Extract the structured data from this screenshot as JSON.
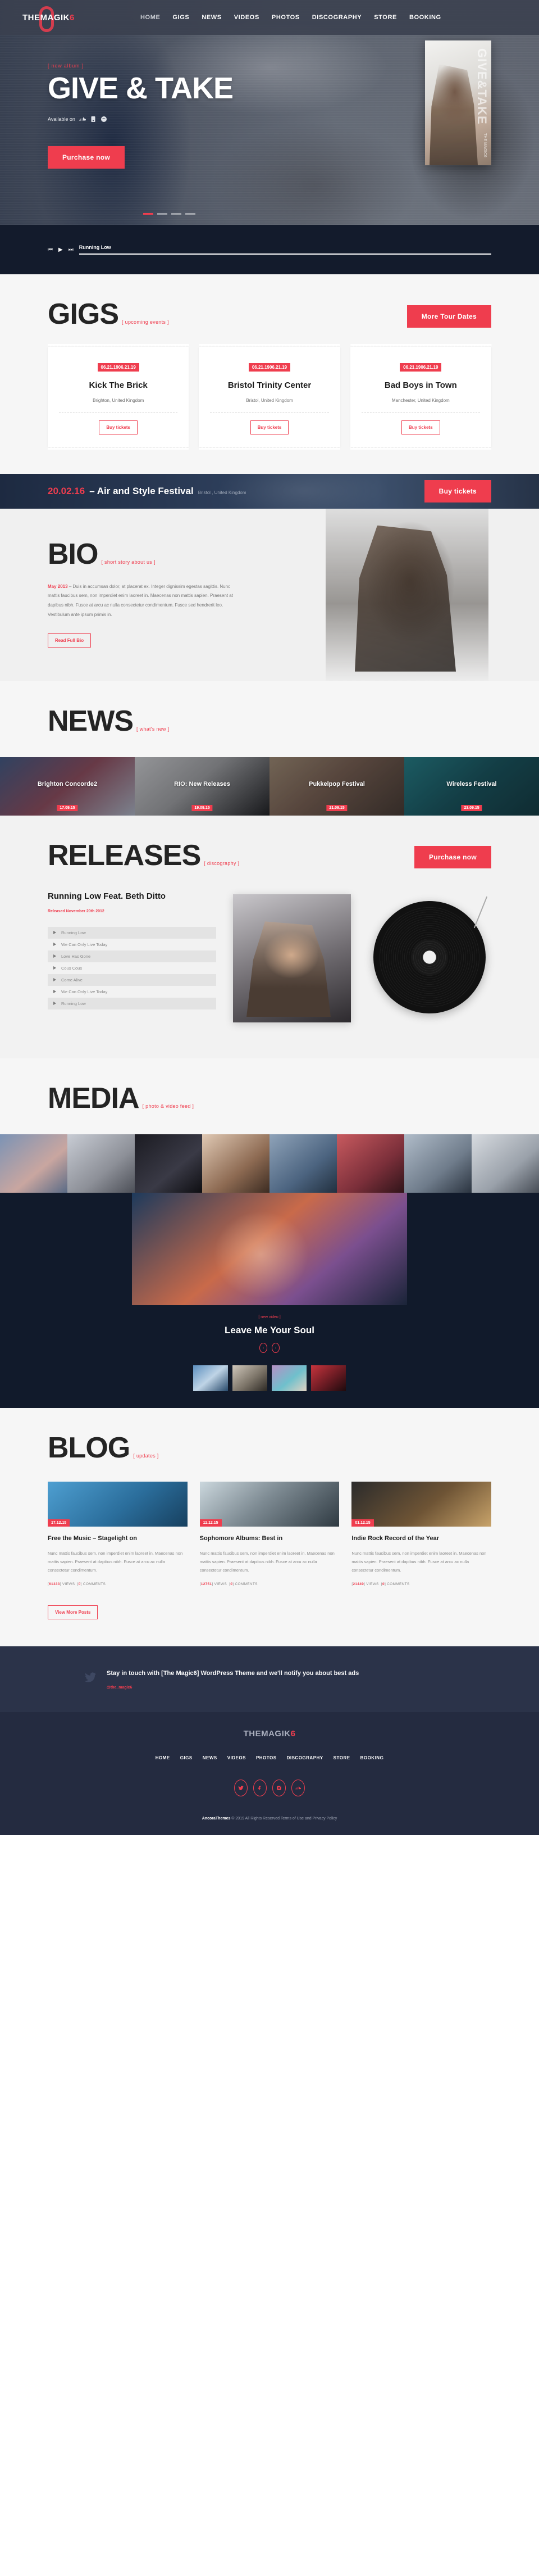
{
  "brand": {
    "name": "THEMAGIK",
    "accent_char": "6",
    "accent_color": "#ef3d4e"
  },
  "nav": {
    "items": [
      {
        "label": "HOME",
        "active": true
      },
      {
        "label": "GIGS",
        "active": false
      },
      {
        "label": "NEWS",
        "active": false
      },
      {
        "label": "VIDEOS",
        "active": false
      },
      {
        "label": "PHOTOS",
        "active": false
      },
      {
        "label": "DISCOGRAPHY",
        "active": false
      },
      {
        "label": "STORE",
        "active": false
      },
      {
        "label": "BOOKING",
        "active": false
      }
    ]
  },
  "hero": {
    "eyebrow": "[ new album ]",
    "title": "GIVE & TAKE",
    "available_label": "Available on",
    "icons": [
      "soundcloud-icon",
      "itunes-icon",
      "spotify-icon"
    ],
    "cta": "Purchase now",
    "album_cover_title": "GIVE&TAKE",
    "album_cover_brand": "THE MAGIC6",
    "slides": 4,
    "active_slide": 1
  },
  "player": {
    "track_title": "Running Low",
    "prev_label": "⏮",
    "play_label": "▶",
    "next_label": "⏭",
    "progress_percent": 100
  },
  "gigs": {
    "title": "GIGS",
    "tag": "[ upcoming events ]",
    "more_button": "More Tour Dates",
    "cards": [
      {
        "date": "06.21.1906.21.19",
        "name": "Kick The Brick",
        "location": "Brighton, United Kingdom",
        "button": "Buy tickets"
      },
      {
        "date": "06.21.1906.21.19",
        "name": "Bristol Trinity Center",
        "location": "Bristol, United Kingdom",
        "button": "Buy tickets"
      },
      {
        "date": "06.21.1906.21.19",
        "name": "Bad Boys in Town",
        "location": "Manchester, United Kingdom",
        "button": "Buy tickets"
      }
    ]
  },
  "festival": {
    "date": "20.02.16",
    "name": "– Air and Style Festival",
    "location": "Bristol , United Kingdom",
    "button": "Buy tickets"
  },
  "bio": {
    "title": "BIO",
    "tag": "[ short story about us ]",
    "date_prefix": "May 2013",
    "paragraph": " – Duis in accumsan dolor, at placerat ex. Integer dignissim egestas sagittis. Nunc mattis faucibus sem, non imperdiet enim laoreet in. Maecenas non mattis sapien. Praesent at dapibus nibh. Fusce at arcu ac nulla consectetur condimentum. Fusce sed hendrerit leo. Vestibulum ante ipsum primis in.",
    "cta": "Read Full Bio"
  },
  "news": {
    "title": "NEWS",
    "tag": "[ what's new ]",
    "cards": [
      {
        "title": "Brighton Concorde2",
        "date": "17.09.15"
      },
      {
        "title": "RIO: New Releases",
        "date": "19.09.15"
      },
      {
        "title": "Pukkelpop Festival",
        "date": "21.09.15"
      },
      {
        "title": "Wireless Festival",
        "date": "23.09.15"
      }
    ]
  },
  "releases": {
    "title": "RELEASES",
    "tag": "[ discography ]",
    "purchase_button": "Purchase now",
    "album_title": "Running Low Feat. Beth Ditto",
    "released": "Released November 20th 2012",
    "tracks": [
      "Running Low",
      "We Can Only Live Today",
      "Love Has Gone",
      "Cous Cous",
      "Come Alive",
      "We Can Only Live Today",
      "Running Low"
    ]
  },
  "media": {
    "title": "MEDIA",
    "tag": "[ photo & video feed ]",
    "tiles": 8
  },
  "video": {
    "tag": "[ new video ]",
    "title": "Leave Me Your Soul",
    "prev_arrow": "‹",
    "next_arrow": "›",
    "thumbs": 4
  },
  "blog": {
    "title": "BLOG",
    "tag": "[ updates ]",
    "more_button": "View More Posts",
    "posts": [
      {
        "date": "17.12.15",
        "title": "Free the Music – Stagelight on",
        "excerpt": "Nunc mattis faucibus sem, non imperdiet enim laoreet in. Maecenas non mattis sapien. Praesent at dapibus nibh. Fusce at arcu ac nulla consectetur condimentum.",
        "views": "61333",
        "views_label": "VIEWS",
        "comments": "0",
        "comments_label": "COMMENTS"
      },
      {
        "date": "11.12.15",
        "title": "Sophomore Albums: Best in",
        "excerpt": "Nunc mattis faucibus sem, non imperdiet enim laoreet in. Maecenas non mattis sapien. Praesent at dapibus nibh. Fusce at arcu ac nulla consectetur condimentum.",
        "views": "12751",
        "views_label": "VIEWS",
        "comments": "0",
        "comments_label": "COMMENTS"
      },
      {
        "date": "01.12.15",
        "title": "Indie Rock Record of the Year",
        "excerpt": "Nunc mattis faucibus sem, non imperdiet enim laoreet in. Maecenas non mattis sapien. Praesent at dapibus nibh. Fusce at arcu ac nulla consectetur condimentum.",
        "views": "21449",
        "views_label": "VIEWS",
        "comments": "0",
        "comments_label": "COMMENTS"
      }
    ]
  },
  "newsletter": {
    "icon": "twitter-icon",
    "message": "Stay in touch with [The Magic6] WordPress Theme and we'll notify you about best ads",
    "handle": "@the_magic6"
  },
  "footer": {
    "nav": [
      {
        "label": "HOME"
      },
      {
        "label": "GIGS"
      },
      {
        "label": "NEWS"
      },
      {
        "label": "VIDEOS"
      },
      {
        "label": "PHOTOS"
      },
      {
        "label": "DISCOGRAPHY"
      },
      {
        "label": "STORE"
      },
      {
        "label": "BOOKING"
      }
    ],
    "socials": [
      "twitter-icon",
      "facebook-icon",
      "instagram-icon",
      "soundcloud-icon"
    ],
    "copyright_brand": "AncoraThemes",
    "copyright_text": " © 2019 All Rights Reserved Terms of Use and Privacy Policy"
  }
}
